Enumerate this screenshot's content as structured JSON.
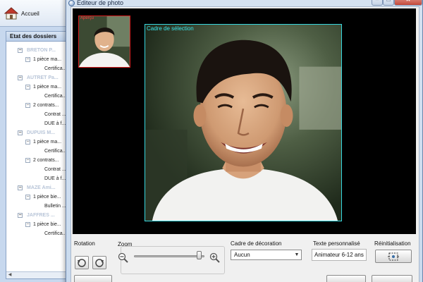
{
  "background_app": {
    "home_label": "Accueil",
    "panel_title": "Etat des dossiers",
    "tree": [
      {
        "level": 0,
        "text": "BRETON P..."
      },
      {
        "level": 1,
        "text": "1 pièce ma..."
      },
      {
        "level": 2,
        "text": "Certifica..."
      },
      {
        "level": 0,
        "text": "AUTRET Pa..."
      },
      {
        "level": 1,
        "text": "1 pièce ma..."
      },
      {
        "level": 2,
        "text": "Certifica..."
      },
      {
        "level": 1,
        "text": "2 contrats..."
      },
      {
        "level": 2,
        "text": "Contrat ..."
      },
      {
        "level": 2,
        "text": "DUE à f..."
      },
      {
        "level": 0,
        "text": "DUPUIS M..."
      },
      {
        "level": 1,
        "text": "1 pièce ma..."
      },
      {
        "level": 2,
        "text": "Certifica..."
      },
      {
        "level": 1,
        "text": "2 contrats..."
      },
      {
        "level": 2,
        "text": "Contrat ..."
      },
      {
        "level": 2,
        "text": "DUE à f..."
      },
      {
        "level": 0,
        "text": "MAZE Ami..."
      },
      {
        "level": 1,
        "text": "1 pièce bie..."
      },
      {
        "level": 2,
        "text": "Bulletin ..."
      },
      {
        "level": 0,
        "text": "JAFFRES ..."
      },
      {
        "level": 1,
        "text": "1 pièce bie..."
      },
      {
        "level": 2,
        "text": "Certifica..."
      }
    ]
  },
  "dialog": {
    "title": "Editeur de photo",
    "thumbnail_label": "Aperçu",
    "selection_label": "Cadre de sélection",
    "controls": {
      "rotation_label": "Rotation",
      "zoom_label": "Zoom",
      "zoom_level": 0.92,
      "frame_label": "Cadre de décoration",
      "frame_value": "Aucun",
      "text_label": "Texte personnalisé",
      "text_value": "Animateur 6-12 ans",
      "reset_label": "Réinitialisation"
    }
  },
  "colors": {
    "selection_frame": "#37d7e0",
    "thumbnail_frame": "#d81e1e",
    "photo_background": "#000000"
  }
}
